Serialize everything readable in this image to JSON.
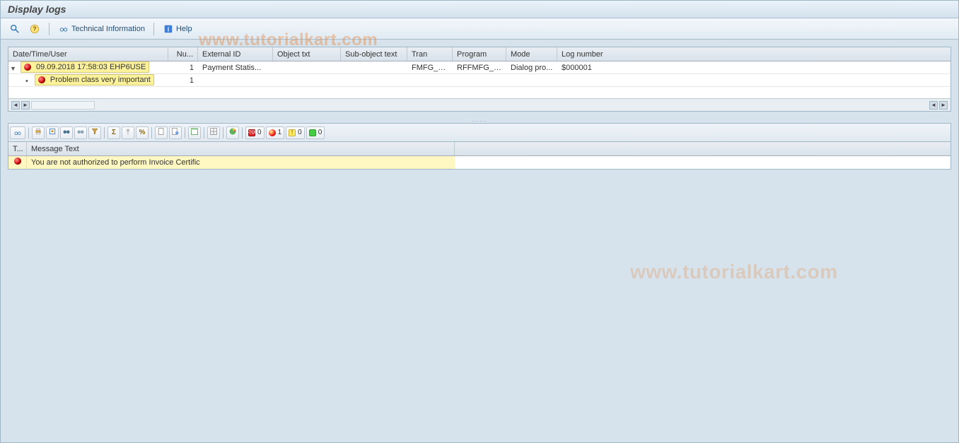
{
  "title": "Display logs",
  "toolbar": {
    "tech_info_label": "Technical Information",
    "help_label": "Help"
  },
  "watermark": "www.tutorialkart.com",
  "log_table": {
    "headers": {
      "date_user": "Date/Time/User",
      "num": "Nu...",
      "ext_id": "External ID",
      "obj_txt": "Object txt",
      "subobj": "Sub-object text",
      "tran": "Tran",
      "program": "Program",
      "mode": "Mode",
      "log_no": "Log number"
    },
    "rows": [
      {
        "date_user": "09.09.2018  17:58:03  EHP6USE",
        "num": "1",
        "ext_id": "Payment Statis...",
        "obj_txt": "",
        "subobj": "",
        "tran": "FMFG_SS...",
        "program": "RFFMFG_S...",
        "mode": "Dialog pro...",
        "log_no": "$000001"
      }
    ],
    "child_label": "Problem class very important",
    "child_num": "1"
  },
  "msg_table": {
    "headers": {
      "type": "T...",
      "text": "Message Text"
    },
    "rows": [
      {
        "text": "You are not authorized to perform Invoice Certific"
      }
    ]
  },
  "counters": {
    "stop": "0",
    "error": "1",
    "warn": "0",
    "ok": "0"
  }
}
